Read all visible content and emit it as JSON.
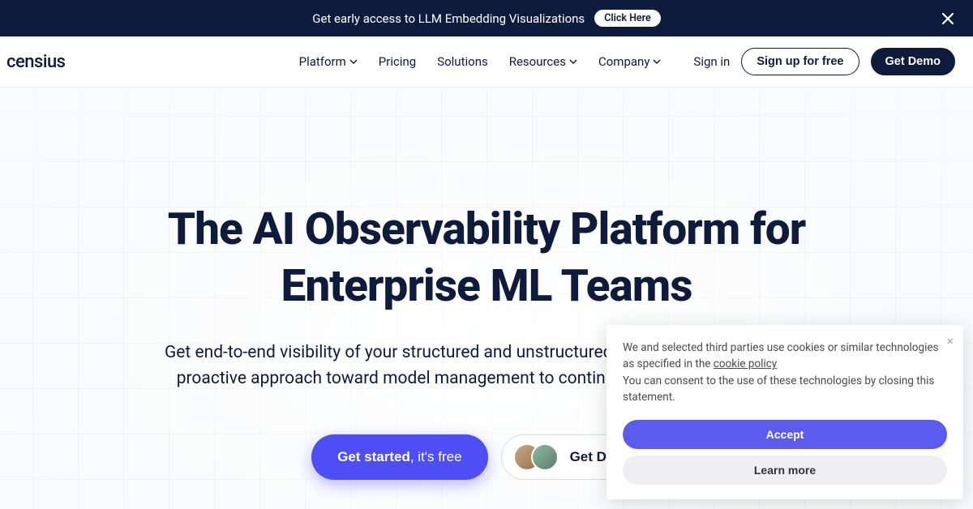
{
  "announcement": {
    "text": "Get early access to LLM Embedding Visualizations",
    "cta": "Click Here"
  },
  "brand": "censius",
  "nav": {
    "items": [
      {
        "label": "Platform",
        "dropdown": true
      },
      {
        "label": "Pricing",
        "dropdown": false
      },
      {
        "label": "Solutions",
        "dropdown": false
      },
      {
        "label": "Resources",
        "dropdown": true
      },
      {
        "label": "Company",
        "dropdown": true
      }
    ],
    "signin": "Sign in",
    "signup": "Sign up for free",
    "demo": "Get Demo"
  },
  "hero": {
    "title_line1": "The AI Observability Platform for",
    "title_line2": "Enterprise ML Teams",
    "subtitle_line1": "Get end-to-end visibility of your structured and unstructured production models with a",
    "subtitle_line2": "proactive approach toward model management to continuously deliver reliable ML",
    "get_started_bold": "Get started",
    "get_started_light": ", it's free",
    "get_demo": "Get Demo"
  },
  "cookie": {
    "text1_pre": "We and selected third parties use cookies or similar technologies as specified in the ",
    "policy_link": "cookie policy",
    "text2": "You can consent to the use of these technologies by closing this statement.",
    "accept": "Accept",
    "learn": "Learn more"
  }
}
